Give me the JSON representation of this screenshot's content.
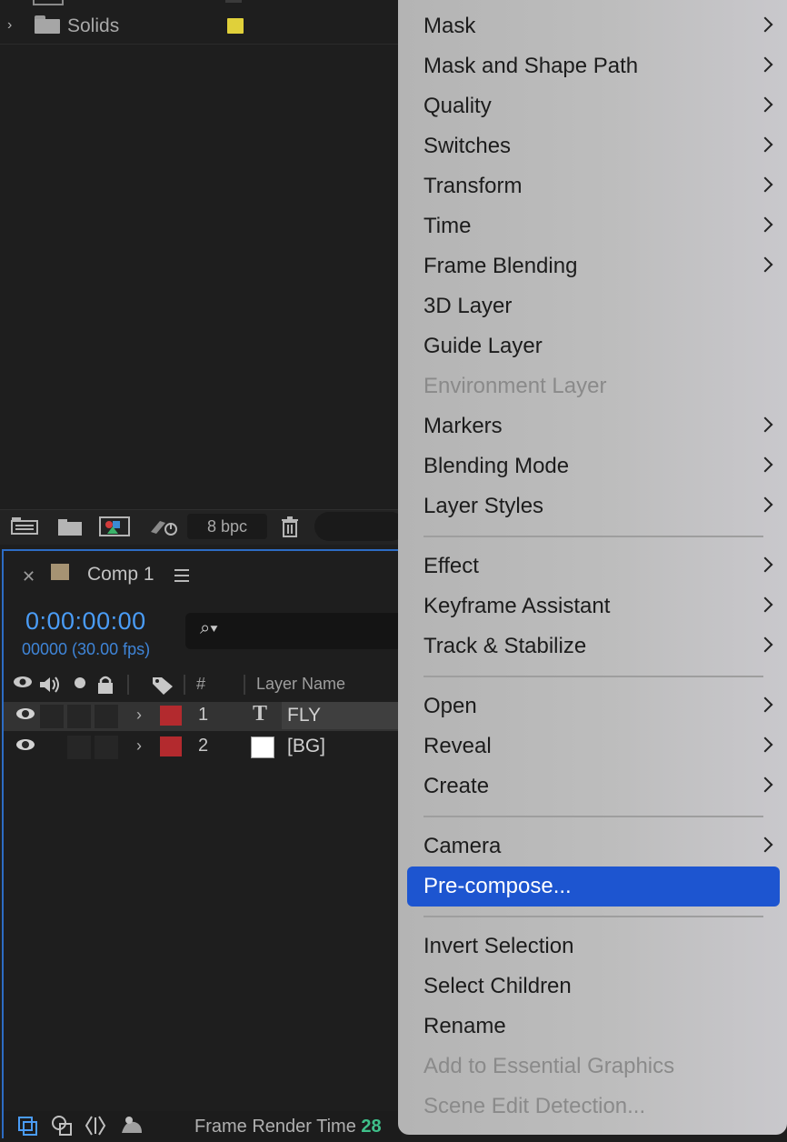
{
  "project_panel": {
    "folder_name": "Solids",
    "folder_swatch_color": "#e0d03a",
    "bit_depth": "8 bpc",
    "toolbar_icons": [
      "interpret-footage-icon",
      "new-folder-icon",
      "new-composition-icon",
      "render-queue-icon",
      "trash-icon"
    ]
  },
  "comp_panel": {
    "tab_title": "Comp 1",
    "timecode": "0:00:00:00",
    "frame_info": "00000 (30.00 fps)",
    "header": {
      "num": "#",
      "layer_name": "Layer Name"
    },
    "layers": [
      {
        "num": "1",
        "name": "FLY",
        "type": "text",
        "label_color": "#b32a2e",
        "selected": true
      },
      {
        "num": "2",
        "name": "[BG]",
        "type": "solid",
        "label_color": "#b32a2e",
        "selected": false
      }
    ],
    "bottom_bar": {
      "label": "Frame Render Time",
      "value": "28"
    }
  },
  "context_menu": {
    "items": [
      {
        "label": "Mask",
        "submenu": true
      },
      {
        "label": "Mask and Shape Path",
        "submenu": true
      },
      {
        "label": "Quality",
        "submenu": true
      },
      {
        "label": "Switches",
        "submenu": true
      },
      {
        "label": "Transform",
        "submenu": true
      },
      {
        "label": "Time",
        "submenu": true
      },
      {
        "label": "Frame Blending",
        "submenu": true
      },
      {
        "label": "3D Layer",
        "submenu": false
      },
      {
        "label": "Guide Layer",
        "submenu": false
      },
      {
        "label": "Environment Layer",
        "submenu": false,
        "disabled": true
      },
      {
        "label": "Markers",
        "submenu": true
      },
      {
        "label": "Blending Mode",
        "submenu": true
      },
      {
        "label": "Layer Styles",
        "submenu": true
      },
      {
        "label": "Effect",
        "submenu": true
      },
      {
        "label": "Keyframe Assistant",
        "submenu": true
      },
      {
        "label": "Track & Stabilize",
        "submenu": true
      },
      {
        "label": "Open",
        "submenu": true
      },
      {
        "label": "Reveal",
        "submenu": true
      },
      {
        "label": "Create",
        "submenu": true
      },
      {
        "label": "Camera",
        "submenu": true
      },
      {
        "label": "Pre-compose...",
        "submenu": false,
        "highlighted": true
      },
      {
        "label": "Invert Selection",
        "submenu": false
      },
      {
        "label": "Select Children",
        "submenu": false
      },
      {
        "label": "Rename",
        "submenu": false
      },
      {
        "label": "Add to Essential Graphics",
        "submenu": false,
        "disabled": true
      },
      {
        "label": "Scene Edit Detection...",
        "submenu": false,
        "disabled": true
      }
    ],
    "highlight_color": "#1d55d0"
  }
}
